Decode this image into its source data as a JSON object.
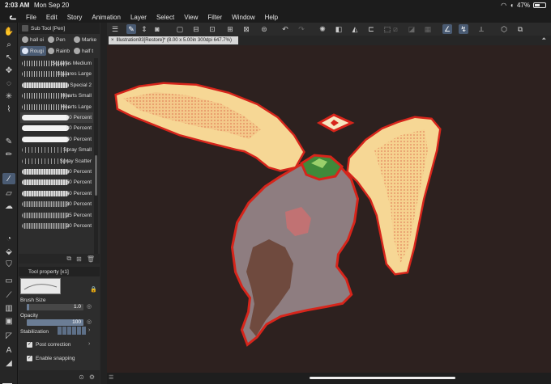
{
  "status": {
    "time": "2:03 AM",
    "date": "Mon Sep 20",
    "battery": "47%",
    "battery_level": 0.47
  },
  "menu": {
    "logo": "Clip Studio logo",
    "items": [
      "File",
      "Edit",
      "Story",
      "Animation",
      "Layer",
      "Select",
      "View",
      "Filter",
      "Window",
      "Help"
    ]
  },
  "subtool": {
    "title": "Sub Tool [Pen]",
    "tabs": [
      {
        "label": "hall oi",
        "active": false
      },
      {
        "label": "Pen",
        "active": false
      },
      {
        "label": "Marke",
        "active": false
      },
      {
        "label": "Rougi",
        "active": true
      },
      {
        "label": "Rainb",
        "active": false
      },
      {
        "label": "half t",
        "active": false
      }
    ],
    "brushes": [
      {
        "name": "Squares Medium",
        "style": "dots"
      },
      {
        "name": "Squares Large",
        "style": "dots"
      },
      {
        "name": "Special 2",
        "style": "gray"
      },
      {
        "name": "Hearts Small",
        "style": "dots"
      },
      {
        "name": "Hearts Large",
        "style": "dots"
      },
      {
        "name": "90 Percent",
        "style": "white",
        "selected": true
      },
      {
        "name": "80 Percent",
        "style": "white"
      },
      {
        "name": "70 Percent",
        "style": "white"
      },
      {
        "name": "Spray Small",
        "style": "spray"
      },
      {
        "name": "Spray Scatter",
        "style": "spray"
      },
      {
        "name": "60 Percent",
        "style": "gray"
      },
      {
        "name": "50 Percent",
        "style": "gray"
      },
      {
        "name": "40 Percent",
        "style": "gray"
      },
      {
        "name": "30 Percent",
        "style": "darkgray"
      },
      {
        "name": "25 Percent",
        "style": "darkgray"
      },
      {
        "name": "20 Percent",
        "style": "darkgray"
      }
    ]
  },
  "property": {
    "title": "Tool property [x1]",
    "brush_size_label": "Brush Size",
    "brush_size_value": "1.0",
    "opacity_label": "Opacity",
    "opacity_value": "100",
    "stabilization_label": "Stabilization",
    "post_correction_label": "Post correction",
    "enable_snapping_label": "Enable snapping"
  },
  "canvas_tab": {
    "title": "Illustration93[Restore]* (8.00 x 5.00in 300dpi 647.7%)"
  },
  "colors": {
    "canvas_bg": "#2d211f",
    "active": "#4a5b73",
    "main_color": "#7a4d46",
    "sub_color": "#e8dcd0"
  }
}
